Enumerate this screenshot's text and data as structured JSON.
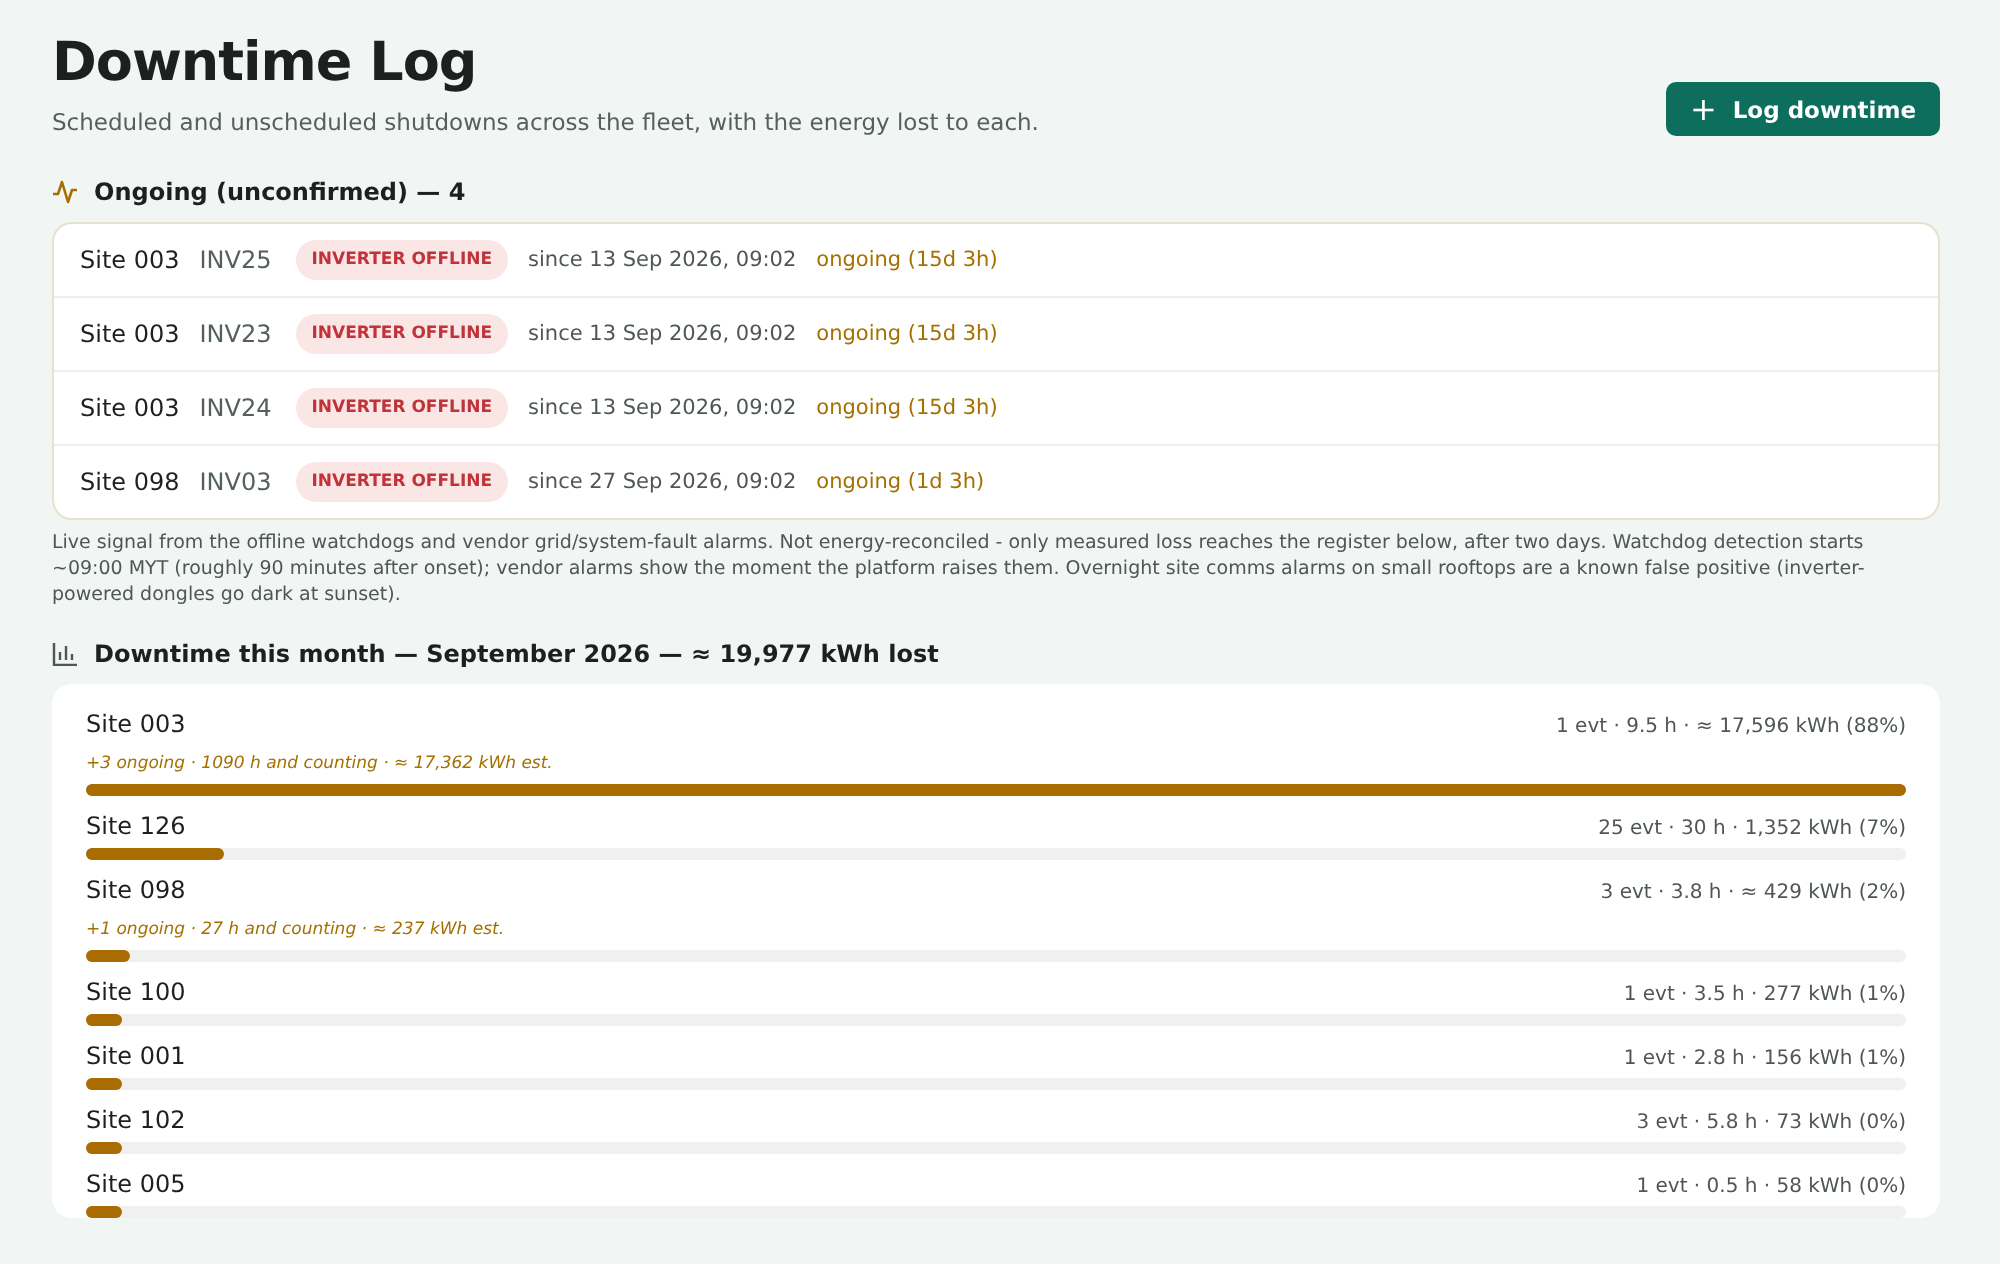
{
  "header": {
    "title": "Downtime Log",
    "subtitle": "Scheduled and unscheduled shutdowns across the fleet, with the energy lost to each.",
    "action": {
      "icon": "+",
      "label": "Log downtime"
    }
  },
  "ongoing": {
    "heading": "Ongoing (unconfirmed) — 4",
    "rows": [
      {
        "site": "Site 003",
        "device": "INV25",
        "badge": "INVERTER OFFLINE",
        "since": "since 13 Sep 2026, 09:02",
        "status": "ongoing (15d 3h)"
      },
      {
        "site": "Site 003",
        "device": "INV23",
        "badge": "INVERTER OFFLINE",
        "since": "since 13 Sep 2026, 09:02",
        "status": "ongoing (15d 3h)"
      },
      {
        "site": "Site 003",
        "device": "INV24",
        "badge": "INVERTER OFFLINE",
        "since": "since 13 Sep 2026, 09:02",
        "status": "ongoing (15d 3h)"
      },
      {
        "site": "Site 098",
        "device": "INV03",
        "badge": "INVERTER OFFLINE",
        "since": "since 27 Sep 2026, 09:02",
        "status": "ongoing (1d 3h)"
      }
    ],
    "note": "Live signal from the offline watchdogs and vendor grid/system-fault alarms. Not energy-reconciled - only measured loss reaches the register below, after two days. Watchdog detection starts ~09:00 MYT (roughly 90 minutes after onset); vendor alarms show the moment the platform raises them. Overnight site comms alarms on small rooftops are a known false positive (inverter-powered dongles go dark at sunset)."
  },
  "month": {
    "heading": "Downtime this month — September 2026 — ≈ 19,977 kWh lost",
    "sites": [
      {
        "name": "Site 003",
        "summary": "1 evt · 9.5 h · ≈ 17,596 kWh (88%)",
        "ongoing_note": "+3 ongoing · 1090 h and counting · ≈ 17,362 kWh est.",
        "level": 1.0
      },
      {
        "name": "Site 126",
        "summary": "25 evt · 30 h · 1,352 kWh (7%)",
        "level": 0.076
      },
      {
        "name": "Site 098",
        "summary": "3 evt · 3.8 h · ≈ 429 kWh (2%)",
        "ongoing_note": "+1 ongoing · 27 h and counting · ≈ 237 kWh est.",
        "level": 0.024
      },
      {
        "name": "Site 100",
        "summary": "1 evt · 3.5 h · 277 kWh (1%)",
        "level": 0.02
      },
      {
        "name": "Site 001",
        "summary": "1 evt · 2.8 h · 156 kWh (1%)",
        "level": 0.02
      },
      {
        "name": "Site 102",
        "summary": "3 evt · 5.8 h · 73 kWh (0%)",
        "level": 0.02
      },
      {
        "name": "Site 005",
        "summary": "1 evt · 0.5 h · 58 kWh (0%)",
        "level": 0.02
      }
    ]
  }
}
